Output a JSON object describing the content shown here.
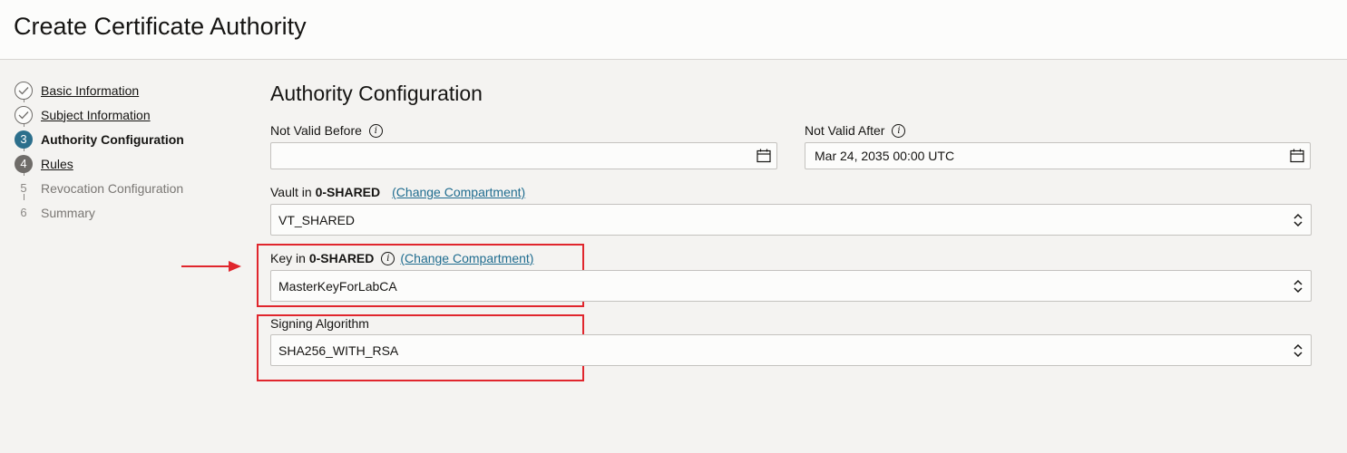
{
  "header": {
    "title": "Create Certificate Authority"
  },
  "steps": [
    {
      "number": "",
      "label": "Basic Information",
      "state": "complete"
    },
    {
      "number": "",
      "label": "Subject Information",
      "state": "complete"
    },
    {
      "number": "3",
      "label": "Authority Configuration",
      "state": "current"
    },
    {
      "number": "4",
      "label": "Rules",
      "state": "visited"
    },
    {
      "number": "5",
      "label": "Revocation Configuration",
      "state": "upcoming"
    },
    {
      "number": "6",
      "label": "Summary",
      "state": "upcoming"
    }
  ],
  "form": {
    "title": "Authority Configuration",
    "not_valid_before": {
      "label": "Not Valid Before",
      "value": ""
    },
    "not_valid_after": {
      "label": "Not Valid After",
      "value": "Mar 24, 2035 00:00 UTC"
    },
    "vault": {
      "label_prefix": "Vault in",
      "compartment": "0-SHARED",
      "change_link": "(Change Compartment)",
      "value": "VT_SHARED"
    },
    "key": {
      "label_prefix": "Key in",
      "compartment": "0-SHARED",
      "change_link": "(Change Compartment)",
      "value": "MasterKeyForLabCA"
    },
    "signing_algorithm": {
      "label": "Signing Algorithm",
      "value": "SHA256_WITH_RSA"
    }
  },
  "colors": {
    "highlight": "#e0262d",
    "current_step": "#2c6f8c",
    "link": "#1f6c8f"
  },
  "icons": [
    "check-circle-icon",
    "calendar-icon",
    "info-icon",
    "select-chevrons-icon",
    "arrow-right-icon"
  ]
}
